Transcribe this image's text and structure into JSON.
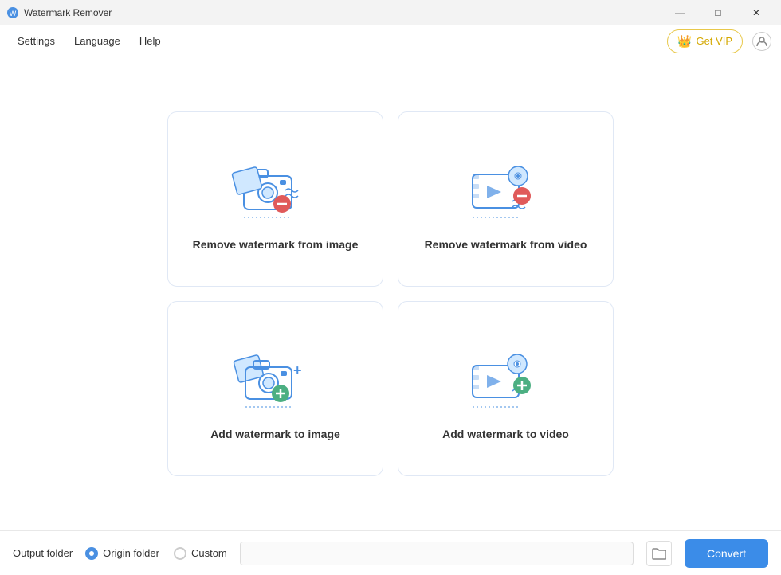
{
  "app": {
    "title": "Watermark Remover",
    "icon_unicode": "🖼"
  },
  "title_bar": {
    "minimize_label": "—",
    "maximize_label": "□",
    "close_label": "✕"
  },
  "menu": {
    "items": [
      {
        "label": "Settings",
        "key": "settings"
      },
      {
        "label": "Language",
        "key": "language"
      },
      {
        "label": "Help",
        "key": "help"
      }
    ],
    "vip_label": "Get VIP",
    "crown": "👑"
  },
  "cards": [
    {
      "key": "remove-image",
      "label": "Remove watermark from image",
      "type": "remove",
      "media": "image"
    },
    {
      "key": "remove-video",
      "label": "Remove watermark from video",
      "type": "remove",
      "media": "video"
    },
    {
      "key": "add-image",
      "label": "Add watermark to image",
      "type": "add",
      "media": "image"
    },
    {
      "key": "add-video",
      "label": "Add watermark to video",
      "type": "add",
      "media": "video"
    }
  ],
  "footer": {
    "output_folder_label": "Output folder",
    "origin_folder_label": "Origin folder",
    "custom_label": "Custom",
    "convert_label": "Convert",
    "path_placeholder": ""
  },
  "colors": {
    "blue_primary": "#4a90e2",
    "blue_light": "#6ab0f5",
    "red_badge": "#e05a5a",
    "green_badge": "#4caf82",
    "teal_body": "#7ec8e3",
    "yellow_crown": "#f5c518"
  }
}
